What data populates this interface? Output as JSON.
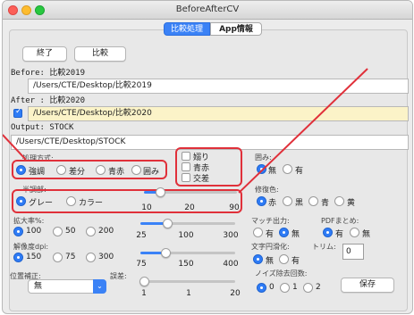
{
  "window": {
    "title": "BeforeAfterCV"
  },
  "tabs": {
    "compare": "比較処理",
    "app_info": "App情報"
  },
  "buttons": {
    "quit": "終了",
    "compare": "比較",
    "save": "保存"
  },
  "before": {
    "label": "Before: 比較2019",
    "path": "/Users/CTE/Desktop/比較2019"
  },
  "after": {
    "label": "After : 比較2020",
    "path": "/Users/CTE/Desktop/比較2020",
    "checked": true
  },
  "output": {
    "label": "Output: STOCK",
    "path": "/Users/CTE/Desktop/STOCK"
  },
  "processing": {
    "label": "処理方式:",
    "options": [
      "強調",
      "差分",
      "青赤",
      "囲み"
    ],
    "selected": "強調"
  },
  "checks": {
    "items": [
      "嫋り",
      "青赤",
      "交差"
    ]
  },
  "surround": {
    "label": "囲み:",
    "options": [
      "無",
      "有"
    ],
    "selected": "無"
  },
  "halftone": {
    "label": "半調部:",
    "options": [
      "グレー",
      "カラー"
    ],
    "selected": "グレー",
    "slider": {
      "ticks": [
        "10",
        "20",
        "90"
      ],
      "value": 20
    }
  },
  "repair_color": {
    "label": "修復色:",
    "options": [
      "赤",
      "黒",
      "青",
      "黄"
    ],
    "selected": "赤"
  },
  "zoom": {
    "label": "拡大率%:",
    "options": [
      "100",
      "50",
      "200"
    ],
    "selected": "100",
    "slider": {
      "ticks": [
        "25",
        "100",
        "300"
      ],
      "value": 100
    }
  },
  "match_output": {
    "label": "マッチ出力:",
    "options": [
      "有",
      "無"
    ],
    "selected": "無"
  },
  "pdf_merge": {
    "label": "PDFまとめ:",
    "options": [
      "有",
      "無"
    ],
    "selected": "有"
  },
  "resolution": {
    "label": "解像度dpi:",
    "options": [
      "150",
      "75",
      "300"
    ],
    "selected": "150",
    "slider": {
      "ticks": [
        "75",
        "150",
        "400"
      ],
      "value": 150
    }
  },
  "text_smoothing": {
    "label": "文字円滑化:",
    "options": [
      "無",
      "有"
    ],
    "selected": "無"
  },
  "trim": {
    "label": "トリム:",
    "value": "0"
  },
  "position": {
    "label": "位置補正:",
    "select_value": "無",
    "error_label": "誤差:",
    "slider": {
      "ticks": [
        "1",
        "1",
        "20"
      ],
      "value": 1
    }
  },
  "noise": {
    "label": "ノイズ除去回数:",
    "options": [
      "0",
      "1",
      "2"
    ],
    "selected": "0"
  },
  "colors": {
    "accent": "#3b82f6",
    "highlight_red": "#e0303a",
    "after_field_bg": "#fbf3c8"
  },
  "icons": {
    "close": "close-light-icon",
    "minimize": "minimize-light-icon",
    "zoom": "zoom-light-icon",
    "dropdown": "chevron-down-icon"
  }
}
